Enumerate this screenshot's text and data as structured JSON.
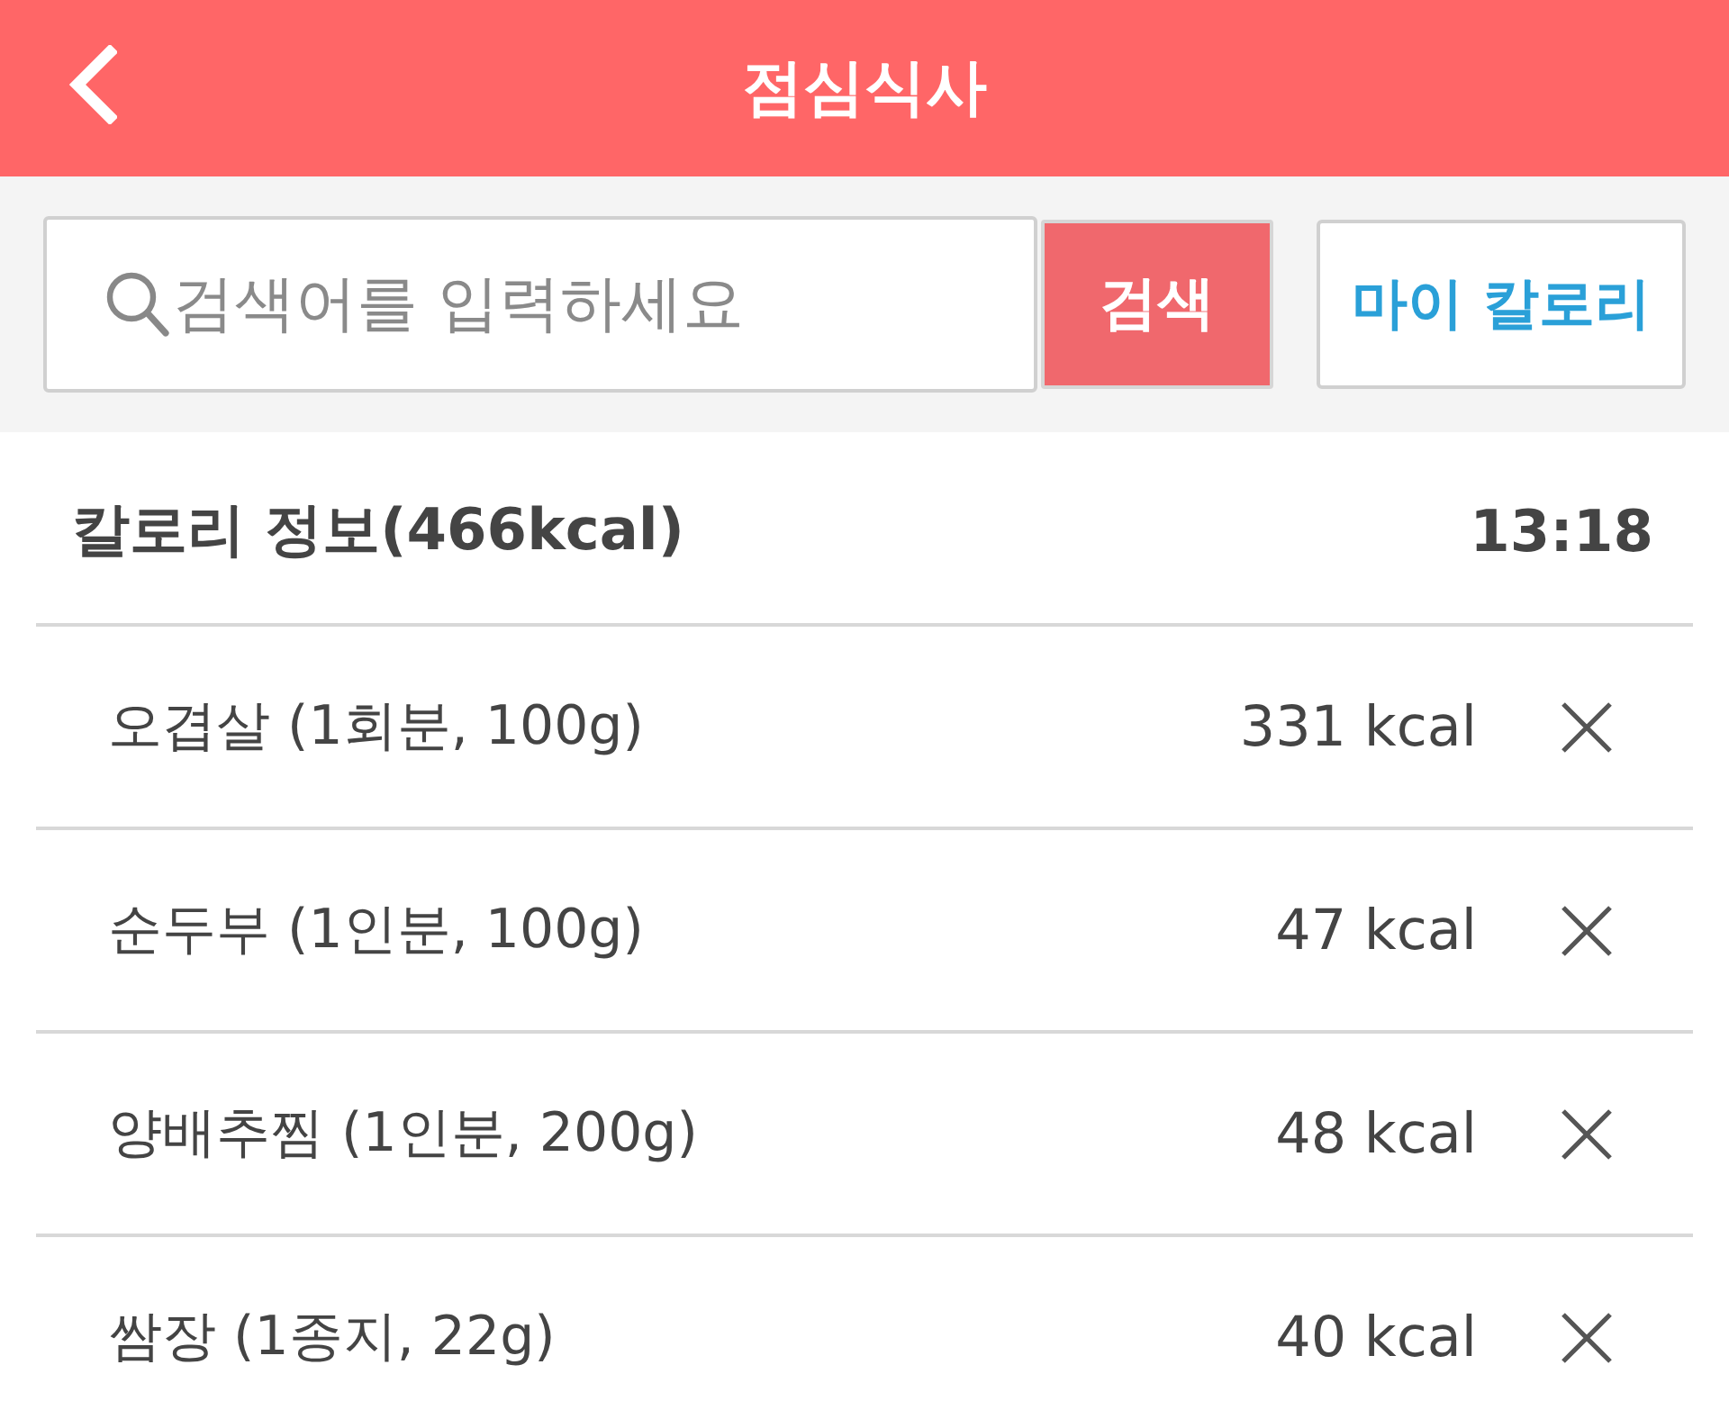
{
  "header": {
    "title": "점심식사"
  },
  "search": {
    "placeholder": "검색어를 입력하세요",
    "button": "검색"
  },
  "my_calorie_button": "마이 칼로리",
  "summary": {
    "title": "칼로리 정보(466kcal)",
    "time": "13:18"
  },
  "items": [
    {
      "name": "오겹살 (1회분, 100g)",
      "calories": "331 kcal"
    },
    {
      "name": "순두부 (1인분, 100g)",
      "calories": "47 kcal"
    },
    {
      "name": "양배추찜 (1인분, 200g)",
      "calories": "48 kcal"
    },
    {
      "name": "쌈장 (1종지, 22g)",
      "calories": "40 kcal"
    }
  ]
}
